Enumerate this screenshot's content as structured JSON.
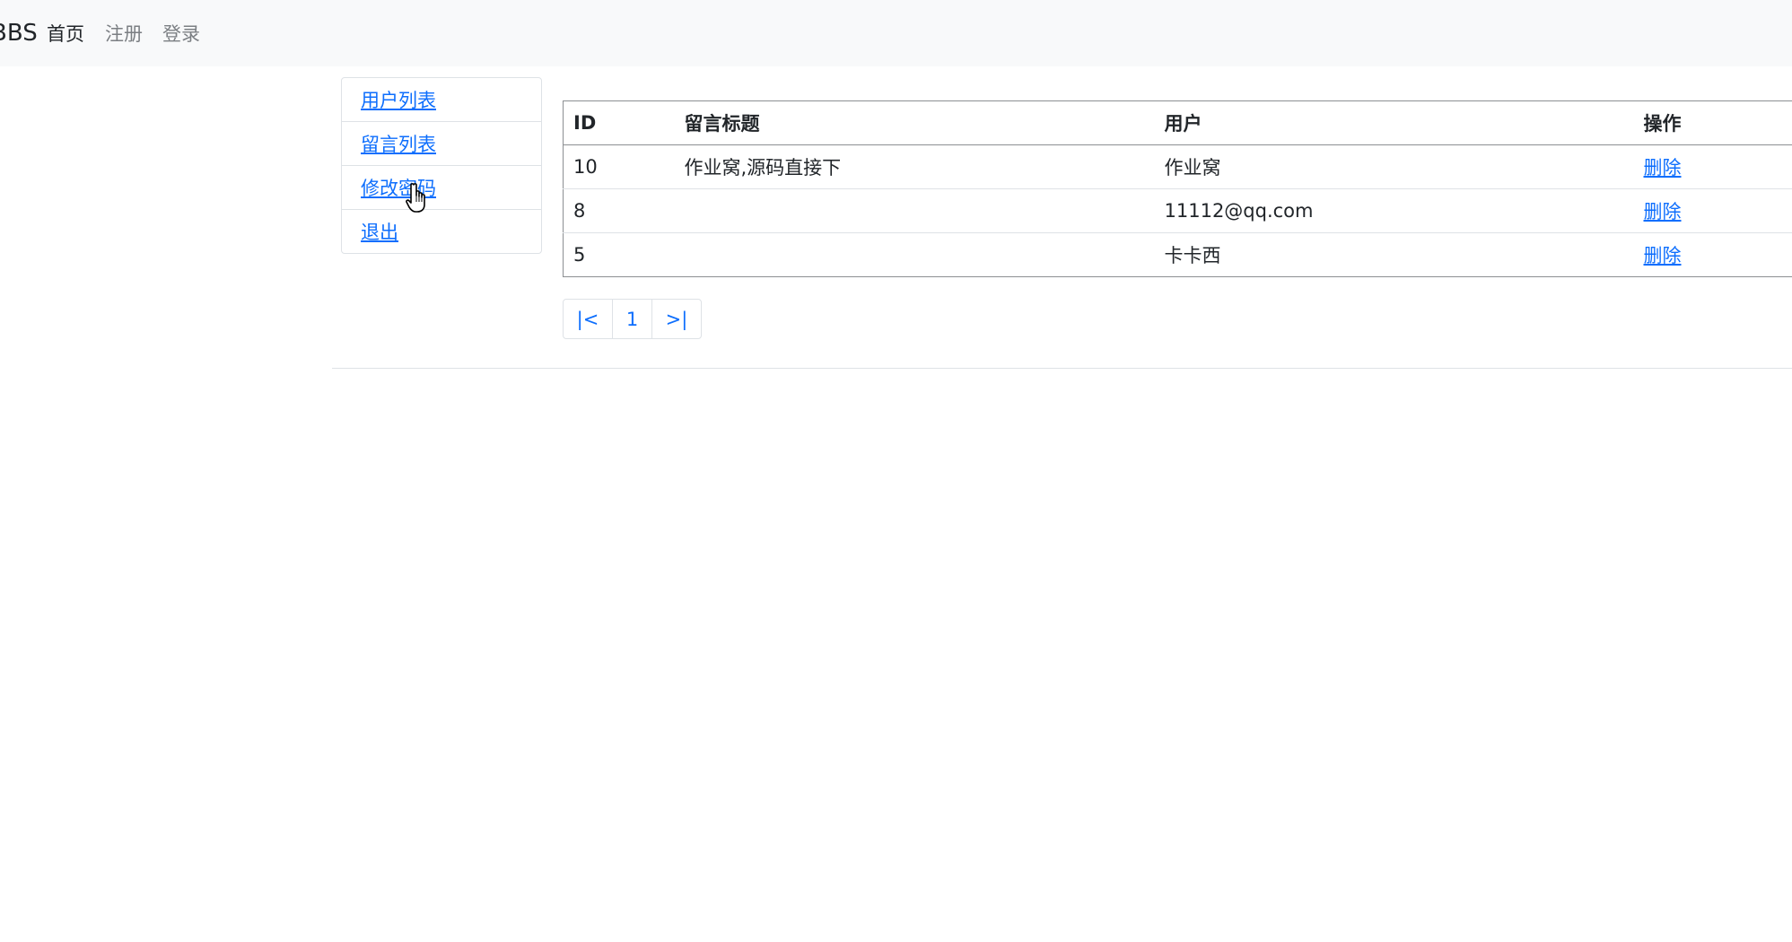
{
  "navbar": {
    "brand": "BBS",
    "links": [
      {
        "label": "首页",
        "active": true
      },
      {
        "label": "注册",
        "active": false
      },
      {
        "label": "登录",
        "active": false
      }
    ]
  },
  "sidebar": {
    "items": [
      {
        "label": "用户列表"
      },
      {
        "label": "留言列表"
      },
      {
        "label": "修改密码"
      },
      {
        "label": "退出"
      }
    ]
  },
  "table": {
    "headers": {
      "id": "ID",
      "title": "留言标题",
      "user": "用户",
      "action": "操作"
    },
    "rows": [
      {
        "id": "10",
        "title": "作业窝,源码直接下",
        "user": "作业窝",
        "action": "删除"
      },
      {
        "id": "8",
        "title": "",
        "user": "11112@qq.com",
        "action": "删除"
      },
      {
        "id": "5",
        "title": "",
        "user": "卡卡西",
        "action": "删除"
      }
    ]
  },
  "pagination": {
    "first": "|<",
    "current": "1",
    "last": ">|"
  },
  "colors": {
    "link": "#0d6efd",
    "navbar_bg": "#f8f9fa",
    "muted": "#7b7f83",
    "border": "#dee2e6"
  },
  "icons": {
    "cursor": "hand-pointer-icon"
  }
}
